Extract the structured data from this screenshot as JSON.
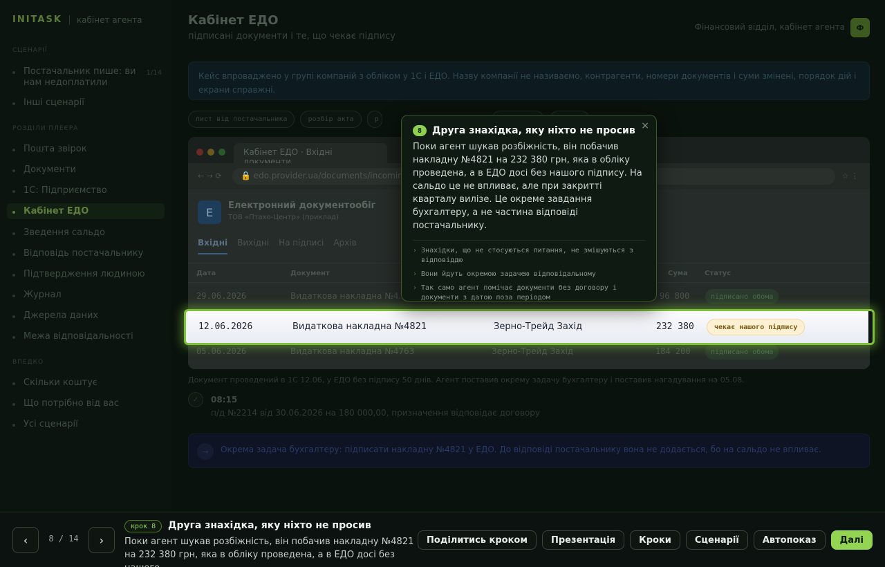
{
  "brand": {
    "logo": "INITASK",
    "subtitle": "кабінет агента"
  },
  "sidebar": {
    "scenarios_heading": "СЦЕНАРІЇ",
    "scenarios": [
      {
        "label": "Постачальник пише: ви нам недоплатили",
        "count": "1/14"
      },
      {
        "label": "Інші сценарії"
      }
    ],
    "section_heading": "РОЗДІЛИ ПЛЕЄРА",
    "sections": [
      "Пошта звірок",
      "Документи",
      "1С: Підприємство",
      "Кабінет ЕДО",
      "Зведення сальдо",
      "Відповідь постачальнику",
      "Підтвердження людиною",
      "Журнал",
      "Джерела даних",
      "Межа відповідальності"
    ],
    "active_section": "Кабінет ЕДО",
    "next_heading": "ВПЕДКО",
    "next_items": [
      "Скільки коштує",
      "Що потрібно від вас",
      "Усі сценарії"
    ]
  },
  "header": {
    "title": "Кабінет ЕДО",
    "subtitle": "підписані документи і те, що чекає підпису",
    "user_label": "Фінансовий відділ, кабінет агента",
    "avatar": "Ф"
  },
  "note": "Кейс впроваджено у групі компаній з обліком у 1С і ЕДО. Назву компанії не називаємо, контрагенти, номери документів і суми змінені, порядок дій і екрани справжні.",
  "chips": [
    "лист від постачальника",
    "розбір акта",
    "р",
    "",
    "подяки"
  ],
  "browser": {
    "tab_title": "Кабінет ЕДО · Вхідні документи",
    "url": "edo.provider.ua/documents/incoming",
    "nav_glyphs": "← → ⟳",
    "more_glyphs": "☆ ⋮",
    "edo_logo": "Е",
    "edo_title": "Електронний документообіг",
    "edo_sub": "ТОВ «Птахо-Центр» (приклад)",
    "tabs": [
      "Вхідні",
      "Вихідні",
      "На підписі",
      "Архів"
    ],
    "columns": {
      "date": "Дата",
      "document": "Документ",
      "counterparty": "",
      "sum": "Сума",
      "status": "Статус"
    },
    "rows": [
      {
        "date": "29.06.2026",
        "document": "Видаткова накладна №4...",
        "counterparty": "",
        "sum": "96 800",
        "status": "підписано обома"
      },
      {
        "date": "12.06.2026",
        "document": "Видаткова накладна №4821",
        "counterparty": "Зерно-Трейд Захід",
        "sum": "232 380",
        "status": "чекає нашого підпису"
      },
      {
        "date": "05.06.2026",
        "document": "Видаткова накладна №4763",
        "counterparty": "Зерно-Трейд Захід",
        "sum": "184 200",
        "status": "підписано обома"
      }
    ]
  },
  "caption": "Документ проведений в 1С 12.06, у ЕДО без підпису 50 днів. Агент поставив окрему задачу бухгалтеру і поставив нагадування на 05.08.",
  "timeline": {
    "time": "08:15",
    "text": "п/д №2214 від 30.06.2026 на 180 000,00, призначення відповідає договору"
  },
  "task": {
    "icon": "→",
    "text": "Окрема задача бухгалтеру: підписати накладну №4821 у ЕДО. До відповіді постачальнику вона не додається, бо на сальдо не впливає."
  },
  "popover": {
    "num": "8",
    "title": "Друга знахідка, яку ніхто не просив",
    "close": "×",
    "body": "Поки агент шукав розбіжність, він побачив накладну №4821 на 232 380 грн, яка в обліку проведена, а в ЕДО досі без нашого підпису. На сальдо це не впливає, але при закритті кварталу вилізе. Це окреме завдання бухгалтеру, а не частина відповіді постачальнику.",
    "bullets": [
      "Знахідки, що не стосуються питання, не змішуються з відповіддю",
      "Вони йдуть окремою задачею відповідальному",
      "Так само агент помічає документи без договору і документи з датою поза періодом"
    ]
  },
  "bottombar": {
    "prev": "‹",
    "next": "›",
    "counter": "8 / 14",
    "step_badge": "крок 8",
    "step_title": "Друга знахідка, яку ніхто не просив",
    "step_desc": "Поки агент шукав розбіжність, він побачив накладну №4821 на 232 380 грн, яка в обліку проведена, а в ЕДО досі без нашого...",
    "actions": [
      "Поділитись кроком",
      "Презентація",
      "Кроки",
      "Сценарії",
      "Автопоказ",
      "Далі"
    ]
  },
  "colors": {
    "accent": "#93d553",
    "highlight_border": "#7ec03a",
    "pending_pill_bg": "#fdf0d3",
    "pending_pill_text": "#7a5a14"
  }
}
